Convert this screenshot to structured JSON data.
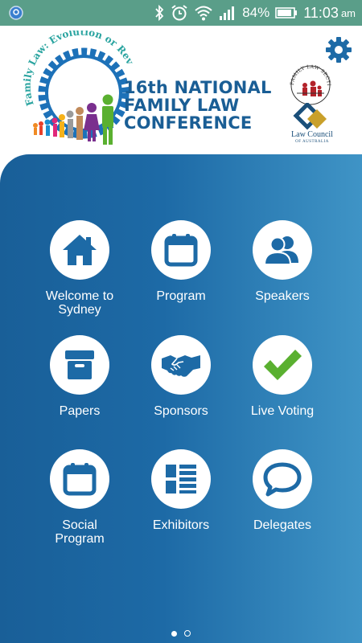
{
  "status_bar": {
    "battery_percent": "84%",
    "time": "11:03",
    "ampm": "am",
    "icons": [
      "app-notification-icon",
      "bluetooth-icon",
      "alarm-icon",
      "wifi-icon",
      "signal-icon",
      "battery-icon"
    ]
  },
  "header": {
    "logo_tagline": "Family Law: Evolution or Revolution",
    "title_lines": [
      "16th NATIONAL",
      "FAMILY LAW",
      "CONFERENCE"
    ],
    "partner_logo_1_text": "FAMILY LAW SECTION",
    "partner_logo_2_name": "Law Council",
    "partner_logo_2_sub": "OF AUSTRALIA"
  },
  "menu": [
    {
      "label_lines": [
        "Welcome to",
        "Sydney"
      ],
      "icon": "home-icon"
    },
    {
      "label_lines": [
        "Program"
      ],
      "icon": "calendar-icon"
    },
    {
      "label_lines": [
        "Speakers"
      ],
      "icon": "people-icon"
    },
    {
      "label_lines": [
        "Papers"
      ],
      "icon": "archive-box-icon"
    },
    {
      "label_lines": [
        "Sponsors"
      ],
      "icon": "handshake-icon"
    },
    {
      "label_lines": [
        "Live Voting"
      ],
      "icon": "checkmark-icon"
    },
    {
      "label_lines": [
        "Social",
        "Program"
      ],
      "icon": "calendar-icon"
    },
    {
      "label_lines": [
        "Exhibitors"
      ],
      "icon": "list-icon"
    },
    {
      "label_lines": [
        "Delegates"
      ],
      "icon": "speech-bubble-icon"
    }
  ],
  "pager": {
    "pages": 2,
    "active": 1
  },
  "colors": {
    "status_bar": "#5a9e89",
    "panel_start": "#195f98",
    "panel_end": "#3f94c6",
    "title": "#1a5e95",
    "icon_blue": "#1d6aa6",
    "check_green": "#5ab030"
  }
}
